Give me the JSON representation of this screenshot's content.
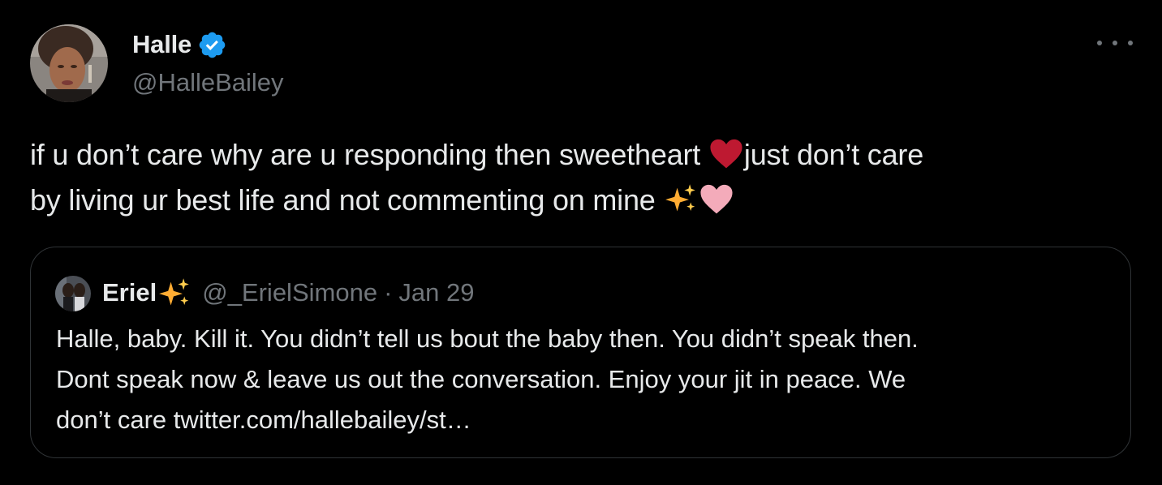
{
  "author": {
    "display_name": "Halle",
    "handle": "@HalleBailey",
    "verified": true,
    "avatar_icon": "profile-photo"
  },
  "tweet": {
    "line1_a": "if u don’t care why are u responding then sweetheart ",
    "line1_b": "just don’t care",
    "line2": "by living ur best life and not commenting on mine ",
    "emojis": [
      "red-heart",
      "sparkles",
      "pink-heart"
    ]
  },
  "quote": {
    "display_name": "Eriel",
    "handle": "@_ErielSimone",
    "separator": "·",
    "date": "Jan 29",
    "lines": [
      "Halle, baby. Kill it. You didn’t tell us bout the baby then. You didn’t speak then.",
      "Dont speak now & leave us out the conversation. Enjoy your jit in peace. We",
      "don’t care twitter.com/hallebailey/st…"
    ]
  },
  "colors": {
    "background": "#000000",
    "text_primary": "#e7e9ea",
    "text_secondary": "#71767b",
    "verified_blue": "#1d9bf0",
    "border": "#2f3336"
  }
}
